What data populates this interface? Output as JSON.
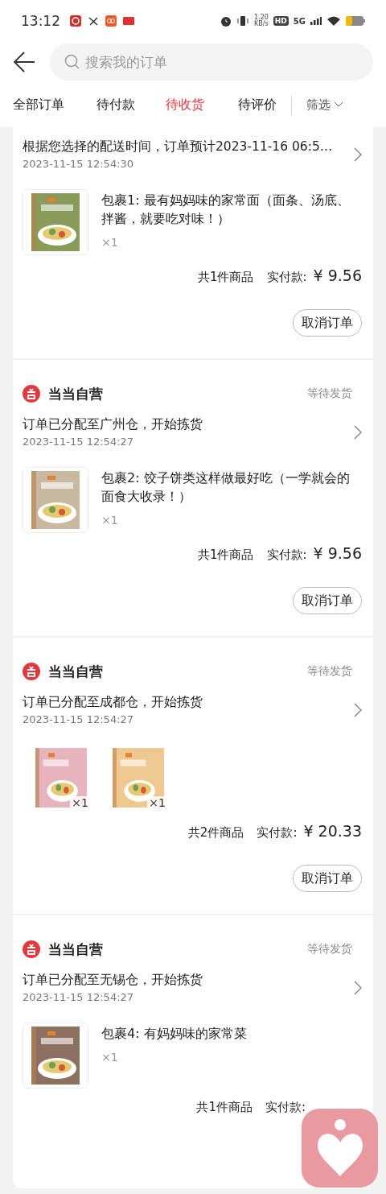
{
  "status_bar": {
    "time": "13:12",
    "net_speed": "1.20",
    "net_unit": "KB/s",
    "hd": "HD",
    "signal": "5G"
  },
  "search": {
    "placeholder": "搜索我的订单"
  },
  "tabs": [
    {
      "label": "全部订单",
      "selected": false
    },
    {
      "label": "待付款",
      "selected": false
    },
    {
      "label": "待收货",
      "selected": true
    },
    {
      "label": "待评价",
      "selected": false
    }
  ],
  "filter": {
    "label": "筛选"
  },
  "orders": [
    {
      "message": "根据您选择的配送时间，订单预计2023-11-16 06:5…",
      "date": "2023-11-15 12:54:30",
      "products": [
        {
          "title": "包裹1: 最有妈妈味的家常面（面条、汤底、拌酱，就要吃对味！）",
          "qty": "×1"
        }
      ],
      "count": "共1件商品",
      "price_label": "实付款:",
      "price": "¥ 9.56",
      "action": "取消订单"
    },
    {
      "store": "当当自营",
      "status": "等待发货",
      "message": "订单已分配至广州仓，开始拣货",
      "date": "2023-11-15 12:54:27",
      "products": [
        {
          "title": "包裹2: 饺子饼类这样做最好吃（一学就会的面食大收录！）",
          "qty": "×1"
        }
      ],
      "count": "共1件商品",
      "price_label": "实付款:",
      "price": "¥ 9.56",
      "action": "取消订单"
    },
    {
      "store": "当当自营",
      "status": "等待发货",
      "message": "订单已分配至成都仓，开始拣货",
      "date": "2023-11-15 12:54:27",
      "products": [
        {
          "qty": "×1"
        },
        {
          "qty": "×1"
        }
      ],
      "count": "共2件商品",
      "price_label": "实付款:",
      "price": "¥ 20.33",
      "action": "取消订单"
    },
    {
      "store": "当当自营",
      "status": "等待发货",
      "message": "订单已分配至无锡仓，开始拣货",
      "date": "2023-11-15 12:54:27",
      "products": [
        {
          "title": "包裹4: 有妈妈味的家常菜",
          "qty": "×1"
        }
      ],
      "count": "共1件商品",
      "price_label": "实付款:"
    }
  ]
}
